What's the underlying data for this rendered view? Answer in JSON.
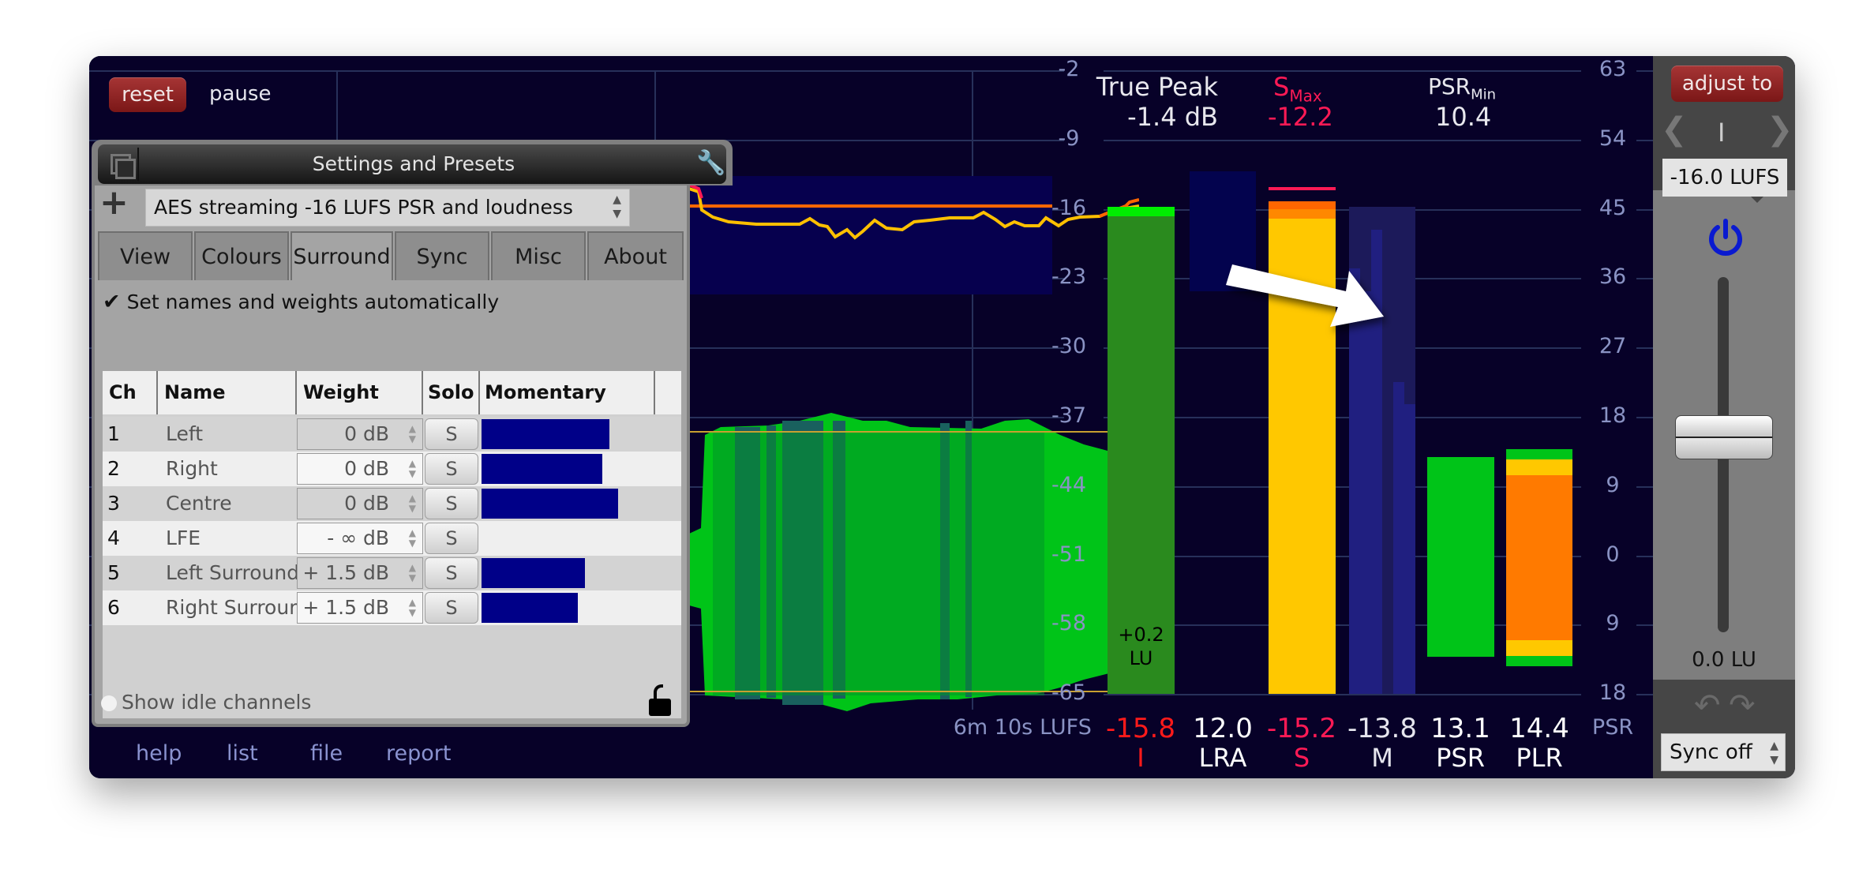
{
  "toolbar": {
    "reset": "reset",
    "pause": "pause"
  },
  "footer_links": [
    "help",
    "list",
    "file",
    "report"
  ],
  "time_label": "6m 10s",
  "lufs_axis": {
    "unit": "LUFS",
    "ticks": [
      "-2",
      "-9",
      "-16",
      "-23",
      "-30",
      "-37",
      "-44",
      "-51",
      "-58",
      "-65"
    ]
  },
  "psr_axis": {
    "unit": "PSR",
    "ticks": [
      "63",
      "54",
      "45",
      "36",
      "27",
      "18",
      "9",
      "0",
      "9",
      "18"
    ]
  },
  "summary": {
    "true_peak_label": "True Peak",
    "true_peak_value": "-1.4 dB",
    "smax_label_main": "S",
    "smax_label_sub": "Max",
    "smax_value": "-12.2",
    "psrmin_label_main": "PSR",
    "psrmin_label_sub": "Min",
    "psrmin_value": "10.4"
  },
  "meters": [
    {
      "key": "I",
      "label": "I",
      "value": "-15.8",
      "color": "#ff1a1a"
    },
    {
      "key": "LRA",
      "label": "LRA",
      "value": "12.0",
      "color": "#ffffff"
    },
    {
      "key": "S",
      "label": "S",
      "value": "-15.2",
      "color": "#ff1a55"
    },
    {
      "key": "M",
      "label": "M",
      "value": "-13.8",
      "color": "#e6e6ee"
    },
    {
      "key": "PSR",
      "label": "PSR",
      "value": "13.1",
      "color": "#ffffff"
    },
    {
      "key": "PLR",
      "label": "PLR",
      "value": "14.4",
      "color": "#ffffff"
    }
  ],
  "integrated_offset": {
    "value": "+0.2",
    "unit": "LU"
  },
  "meter_levels": {
    "integrated_lufs": -15.8,
    "lra_top_lufs": -12.2,
    "lra_bottom_lufs": -24.3,
    "short_term_lufs": -15.2,
    "short_term_max_lufs": -12.2,
    "momentary_lufs": -15.5,
    "psr": 13.1,
    "plr": 14.4
  },
  "right_panel": {
    "adjust_to": "adjust to",
    "mode_indicator": "I",
    "target": "-16.0 LUFS",
    "gain_value": "0.0 LU",
    "gain_fraction": 0.55,
    "sync": "Sync off"
  },
  "settings": {
    "title": "Settings and Presets",
    "preset": "AES streaming -16 LUFS PSR and loudness",
    "tabs": [
      "View",
      "Colours",
      "Surround",
      "Sync",
      "Misc",
      "About"
    ],
    "active_tab": "Surround",
    "auto_names_label": "Set names and weights automatically",
    "auto_names_checked": true,
    "columns": [
      "Ch",
      "Name",
      "Weight",
      "Solo",
      "Momentary loud."
    ],
    "channels": [
      {
        "ch": "1",
        "name": "Left",
        "weight": "0 dB",
        "solo": "S",
        "loudness": 0.73
      },
      {
        "ch": "2",
        "name": "Right",
        "weight": "0 dB",
        "solo": "S",
        "loudness": 0.69
      },
      {
        "ch": "3",
        "name": "Centre",
        "weight": "0 dB",
        "solo": "S",
        "loudness": 0.78
      },
      {
        "ch": "4",
        "name": "LFE",
        "weight": "- ∞ dB",
        "solo": "S",
        "loudness": 0
      },
      {
        "ch": "5",
        "name": "Left Surround",
        "weight": "+ 1.5 dB",
        "solo": "S",
        "loudness": 0.59
      },
      {
        "ch": "6",
        "name": "Right Surround",
        "weight": "+ 1.5 dB",
        "solo": "S",
        "loudness": 0.55
      }
    ],
    "show_idle_label": "Show idle channels",
    "show_idle_checked": false
  },
  "colors": {
    "background": "#070128",
    "grid": "#27305a",
    "axis_text": "#8a93c4",
    "integrated": "#2a8a1e",
    "integrated_top": "#00ee00",
    "lra": "#03034e",
    "short_term": "#ffc800",
    "short_term_top": "#ff8800",
    "short_term_max": "#ff1a55",
    "momentary": "#201f80",
    "psr": "#00c418",
    "plr_main": "#ff7a00",
    "plr_mid": "#ffc800",
    "plr_edge": "#00c418",
    "target_line": "#ff6600",
    "history_line": "#ffc000",
    "momentary_bar": "#000088"
  }
}
